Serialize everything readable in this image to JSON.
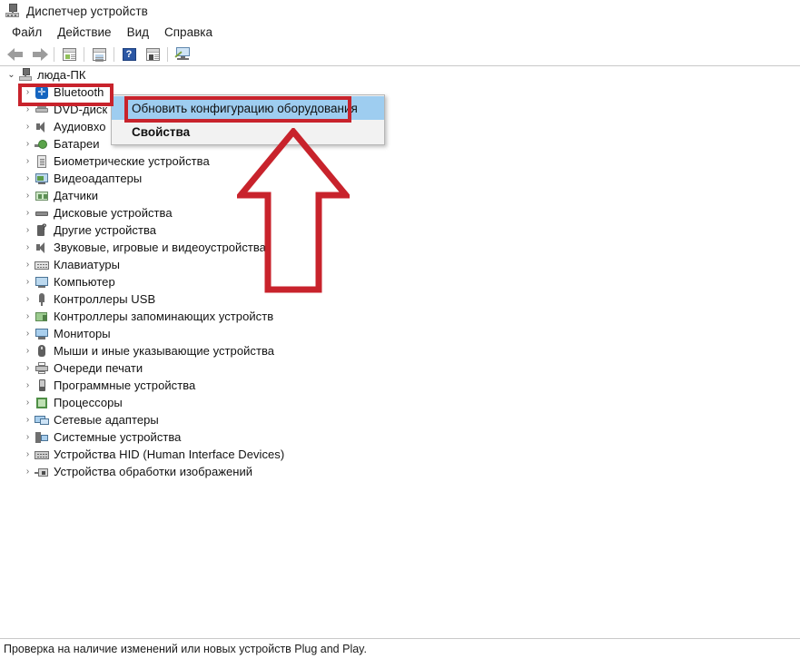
{
  "window": {
    "title": "Диспетчер устройств",
    "app_icon": "device-manager-icon"
  },
  "menubar": {
    "items": [
      {
        "label": "Файл"
      },
      {
        "label": "Действие"
      },
      {
        "label": "Вид"
      },
      {
        "label": "Справка"
      }
    ]
  },
  "toolbar": {
    "buttons": [
      {
        "icon": "back-arrow-icon"
      },
      {
        "icon": "forward-arrow-icon"
      },
      {
        "icon": "properties-icon"
      },
      {
        "icon": "details-icon"
      },
      {
        "icon": "help-icon",
        "glyph": "?"
      },
      {
        "icon": "scan-hardware-icon"
      },
      {
        "icon": "show-hidden-devices-icon"
      }
    ]
  },
  "tree": {
    "root": {
      "label": "люда-ПК",
      "icon": "computer-icon",
      "chevron": "⌄"
    },
    "items": [
      {
        "label": "Bluetooth",
        "icon": "bluetooth-icon",
        "chevron": "›",
        "selected": true
      },
      {
        "label": "DVD-диск",
        "icon": "dvd-drive-icon",
        "chevron": "›",
        "clipped": true
      },
      {
        "label": "Аудиовхо",
        "icon": "audio-inputs-icon",
        "chevron": "›",
        "clipped": true
      },
      {
        "label": "Батареи",
        "icon": "batteries-icon",
        "chevron": "›"
      },
      {
        "label": "Биометрические устройства",
        "icon": "biometric-icon",
        "chevron": "›"
      },
      {
        "label": "Видеоадаптеры",
        "icon": "display-adapters-icon",
        "chevron": "›"
      },
      {
        "label": "Датчики",
        "icon": "sensors-icon",
        "chevron": "›"
      },
      {
        "label": "Дисковые устройства",
        "icon": "disk-drives-icon",
        "chevron": "›"
      },
      {
        "label": "Другие устройства",
        "icon": "other-devices-icon",
        "chevron": "›"
      },
      {
        "label": "Звуковые, игровые и видеоустройства",
        "icon": "sound-video-icon",
        "chevron": "›"
      },
      {
        "label": "Клавиатуры",
        "icon": "keyboards-icon",
        "chevron": "›"
      },
      {
        "label": "Компьютер",
        "icon": "computer-node-icon",
        "chevron": "›"
      },
      {
        "label": "Контроллеры USB",
        "icon": "usb-controllers-icon",
        "chevron": "›"
      },
      {
        "label": "Контроллеры запоминающих устройств",
        "icon": "storage-controllers-icon",
        "chevron": "›"
      },
      {
        "label": "Мониторы",
        "icon": "monitors-icon",
        "chevron": "›"
      },
      {
        "label": "Мыши и иные указывающие устройства",
        "icon": "mice-icon",
        "chevron": "›"
      },
      {
        "label": "Очереди печати",
        "icon": "print-queues-icon",
        "chevron": "›"
      },
      {
        "label": "Программные устройства",
        "icon": "software-devices-icon",
        "chevron": "›"
      },
      {
        "label": "Процессоры",
        "icon": "processors-icon",
        "chevron": "›"
      },
      {
        "label": "Сетевые адаптеры",
        "icon": "network-adapters-icon",
        "chevron": "›"
      },
      {
        "label": "Системные устройства",
        "icon": "system-devices-icon",
        "chevron": "›"
      },
      {
        "label": "Устройства HID (Human Interface Devices)",
        "icon": "hid-devices-icon",
        "chevron": "›"
      },
      {
        "label": "Устройства обработки изображений",
        "icon": "imaging-devices-icon",
        "chevron": "›"
      }
    ]
  },
  "context_menu": {
    "items": [
      {
        "label": "Обновить конфигурацию оборудования",
        "highlighted": true
      },
      {
        "label": "Свойства",
        "bold": true
      }
    ]
  },
  "annotations": {
    "color": "#c8232c",
    "bluetooth_highlight": "red-box-around-bluetooth",
    "menu_item_highlight": "red-box-around-update-hardware",
    "arrow": "red-up-arrow"
  },
  "statusbar": {
    "text": "Проверка на наличие изменений или новых устройств Plug and Play."
  }
}
